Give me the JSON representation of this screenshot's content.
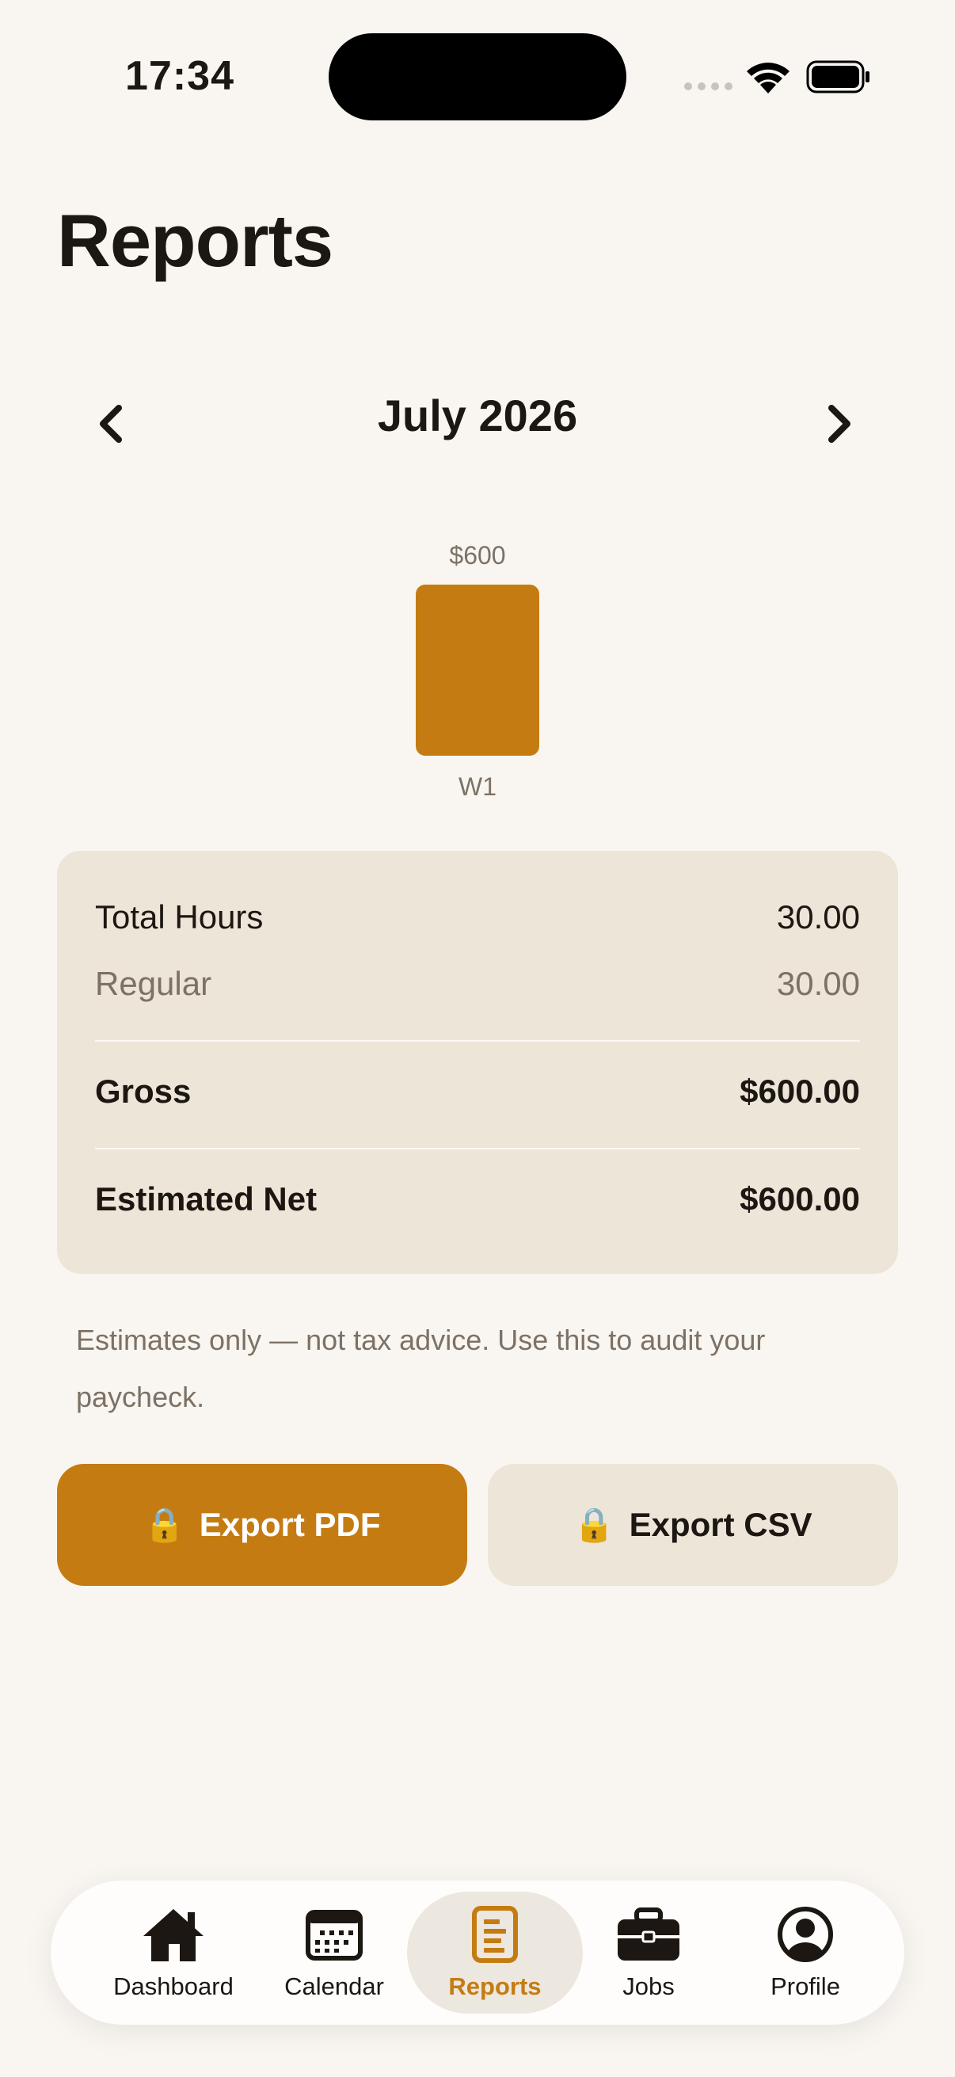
{
  "status_bar": {
    "time": "17:34"
  },
  "page": {
    "title": "Reports"
  },
  "month_nav": {
    "prev_label": "‹",
    "next_label": "›",
    "month": "July 2026"
  },
  "chart_data": {
    "type": "bar",
    "categories": [
      "W1"
    ],
    "values": [
      600
    ],
    "data_labels": [
      "$600"
    ],
    "color": "#c47c12"
  },
  "summary": {
    "total_hours_label": "Total Hours",
    "total_hours_value": "30.00",
    "regular_label": "Regular",
    "regular_value": "30.00",
    "gross_label": "Gross",
    "gross_value": "$600.00",
    "net_label": "Estimated Net",
    "net_value": "$600.00"
  },
  "disclaimer": "Estimates only — not tax advice. Use this to audit your paycheck.",
  "buttons": {
    "pdf_label": "Export PDF",
    "csv_label": "Export CSV",
    "lock_icon": "🔒"
  },
  "tabs": [
    {
      "label": "Dashboard",
      "icon": "house-icon"
    },
    {
      "label": "Calendar",
      "icon": "calendar-icon"
    },
    {
      "label": "Reports",
      "icon": "report-icon",
      "active": true
    },
    {
      "label": "Jobs",
      "icon": "briefcase-icon"
    },
    {
      "label": "Profile",
      "icon": "profile-icon"
    }
  ],
  "colors": {
    "accent": "#c47c12",
    "card": "#ede5d8",
    "background": "#f9f6f1",
    "text": "#1c1712"
  }
}
